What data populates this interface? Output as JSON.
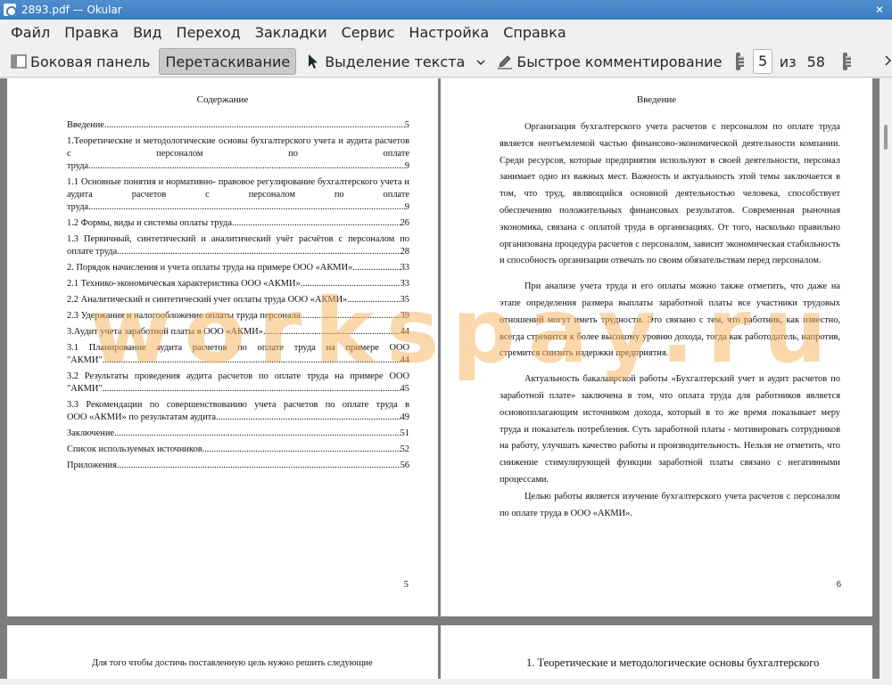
{
  "window": {
    "title": "2893.pdf — Okular"
  },
  "menu": [
    "Файл",
    "Правка",
    "Вид",
    "Переход",
    "Закладки",
    "Сервис",
    "Настройка",
    "Справка"
  ],
  "toolbar": {
    "sidebar": "Боковая панель",
    "browse": "Перетаскивание",
    "text_select": "Выделение текста",
    "annotate": "Быстрое комментирование",
    "page_current": "5",
    "page_of": "из",
    "page_total": "58"
  },
  "page5": {
    "title": "Содержание",
    "toc": [
      {
        "lines": [],
        "last": "Введение",
        "page": "5"
      },
      {
        "lines": [
          "1.Теоретические и методологические основы бухгалтерского учета и аудита расчетов с персоналом по оплате"
        ],
        "last": "труда",
        "page": "9"
      },
      {
        "lines": [
          "1.1 Основные понятия и нормативно- правовое регулирование бухгалтерского учета и аудита расчетов с персоналом по оплате"
        ],
        "last": "труда",
        "page": "9"
      },
      {
        "lines": [],
        "last": "1.2 Формы, виды и системы оплаты труда",
        "page": "26"
      },
      {
        "lines": [
          "1.3 Первичный, синтетический и аналитический учёт расчётов с персоналом по"
        ],
        "last": "оплате труда",
        "page": "28"
      },
      {
        "lines": [],
        "last": " 2. Порядок начисления и учета оплаты труда на примере ООО «АКМИ»",
        "page": "33"
      },
      {
        "lines": [],
        "last": "2.1 Технико-экономическая характеристика ООО «АКМИ»",
        "page": "33"
      },
      {
        "lines": [],
        "last": "2.2 Аналитический и синтетический учет оплаты труда ООО «АКМИ»",
        "page": "35"
      },
      {
        "lines": [],
        "last": "2.3 Удержания и налогообложение оплаты труда персонала",
        "page": "39"
      },
      {
        "lines": [],
        "last": "3.Аудит учета заработной платы в ООО «АКМИ»",
        "page": "44"
      },
      {
        "lines": [
          "3.1 Планирование аудита расчетов по оплате труда на примере ООО"
        ],
        "last": "\"АКМИ\"",
        "page": "44"
      },
      {
        "lines": [
          "3.2 Результаты проведения аудита расчетов по оплате труда на примере ООО"
        ],
        "last": "\"АКМИ\"",
        "page": "45"
      },
      {
        "lines": [
          "3.3 Рекомендации по совершенствованию учета расчетов по оплате труда в"
        ],
        "last": "ООО «АКМИ» по результатам аудита",
        "page": "49"
      },
      {
        "lines": [],
        "last": "Заключение",
        "page": "51"
      },
      {
        "lines": [],
        "last": "Список используемых источников",
        "page": "52"
      },
      {
        "lines": [],
        "last": "Приложения",
        "page": "56"
      }
    ],
    "number": "5"
  },
  "page6": {
    "title": "Введение",
    "paragraphs": [
      "Организация бухгалтерского учета расчетов с персоналом по оплате труда является неотъемлемой частью финансово-экономической деятельности компании. Среди ресурсов, которые предприятия используют в своей деятельности, персонал занимает одно из важных мест. Важность и актуальность этой темы заключается в том, что труд, являющийся основной деятельностью человека, способствует обеспечению положительных финансовых результатов. Современная рыночная экономика, связана с оплатой труда в организациях. От того, насколько правильно организована процедура расчетов с персоналом, зависит экономическая стабильность и способность организации отвечать по своим обязательствам перед персоналом.",
      "При анализе учета труда и его оплаты можно также отметить, что даже на этапе определения размера выплаты заработной платы все участники трудовых отношений могут иметь трудности. Это связано с тем, что работник, как известно, всегда стремится к более высокому уровню дохода, тогда как работодатель, напротив, стремится снизить издержки предприятия.",
      "Актуальность бакалаврской работы «Бухгалтерский учет и аудит расчетов по заработной плате» заключена в том, что оплата труда для работников является основополагающим источником дохода, который в то же время показывает меру труда и показатель потребления. Суть заработной платы - мотивировать сотрудников на работу, улучшать качество работы и производительность. Нельзя не отметить, что снижение стимулирующей функции заработной платы связано с негативными процессами.",
      "Целью работы является изучение бухгалтерского учета расчетов с персоналом по оплате труда в ООО «АКМИ»."
    ],
    "number": "6"
  },
  "page7": {
    "text": "Для того чтобы достичь поставленную цель нужно решить следующие"
  },
  "page8": {
    "text": "1. Теоретические и методологические основы бухгалтерского"
  },
  "watermark": "workspay.ru"
}
